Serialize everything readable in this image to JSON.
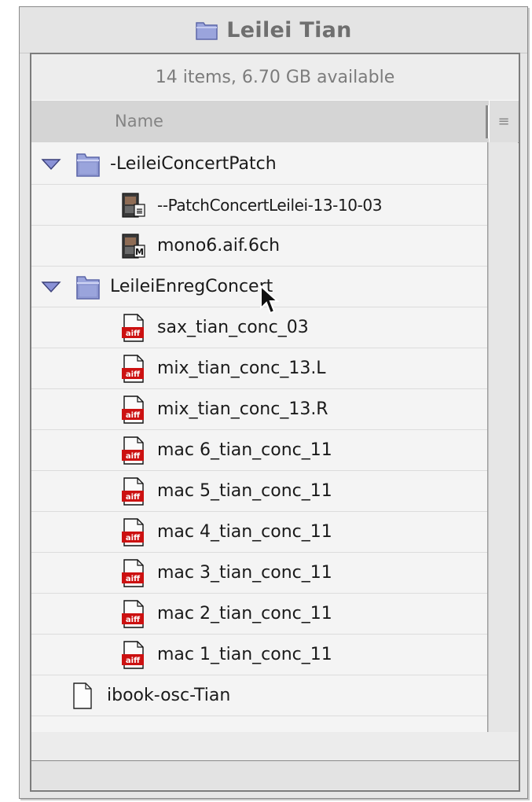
{
  "window": {
    "title": "Leilei Tian",
    "title_icon": "folder-icon",
    "status": "14 items, 6.70 GB available",
    "column_header": "Name",
    "sort_button": "≡"
  },
  "items": [
    {
      "label": "-LeileiConcertPatch",
      "kind": "folder",
      "expanded": true,
      "level": 0
    },
    {
      "label": "--PatchConcertLeilei-13-10-03",
      "kind": "patch-document",
      "level": 1
    },
    {
      "label": "mono6.aif.6ch",
      "kind": "media-document",
      "level": 1
    },
    {
      "label": "LeileiEnregConcert",
      "kind": "folder",
      "expanded": true,
      "level": 0
    },
    {
      "label": "sax_tian_conc_03",
      "kind": "aiff",
      "level": 1
    },
    {
      "label": "mix_tian_conc_13.L",
      "kind": "aiff",
      "level": 1
    },
    {
      "label": "mix_tian_conc_13.R",
      "kind": "aiff",
      "level": 1
    },
    {
      "label": "mac 6_tian_conc_11",
      "kind": "aiff",
      "level": 1
    },
    {
      "label": "mac 5_tian_conc_11",
      "kind": "aiff",
      "level": 1
    },
    {
      "label": "mac 4_tian_conc_11",
      "kind": "aiff",
      "level": 1
    },
    {
      "label": "mac 3_tian_conc_11",
      "kind": "aiff",
      "level": 1
    },
    {
      "label": "mac 2_tian_conc_11",
      "kind": "aiff",
      "level": 1
    },
    {
      "label": "mac 1_tian_conc_11",
      "kind": "aiff",
      "level": 1
    },
    {
      "label": "ibook-osc-Tian",
      "kind": "document",
      "level": 0
    }
  ],
  "icon_badges": {
    "aiff": "aiff",
    "patch-document": "≡",
    "media-document": "M"
  },
  "colors": {
    "folder": "#9aa4dc",
    "folder_dark": "#5c66a8",
    "disclosure": "#8a92d6",
    "aiff_red": "#cc1111"
  }
}
